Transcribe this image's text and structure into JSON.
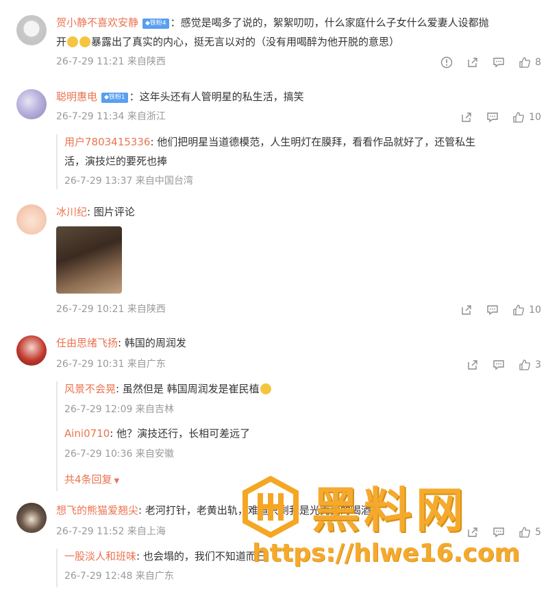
{
  "comments": [
    {
      "username": "贺小静不喜欢安静",
      "badge": "◆铁粉4",
      "text1": "：感觉是喝多了说的，絮絮叨叨，什么家庭什么子女什么爱妻人设都抛",
      "text2a": "开",
      "text2b": "暴露出了真实的内心，挺无言以对的（没有用喝醉为他开脱的意思）",
      "time": "26-7-29 11:21 来自陕西",
      "likes": "8"
    },
    {
      "username": "聪明惠电",
      "badge": "◆铁粉1",
      "text1": "：这年头还有人管明星的私生活，搞笑",
      "time": "26-7-29 11:34 来自浙江",
      "likes": "10",
      "reply": {
        "username": "用户7803415336",
        "text1": ": 他们把明星当道德模范，人生明灯在膜拜，看看作品就好了，还管私生",
        "text2": "活，演技烂的要死也捧",
        "time": "26-7-29 13:37 来自中国台湾"
      }
    },
    {
      "username": "冰川纪",
      "text1": ": 图片评论",
      "time": "26-7-29 10:21 来自陕西",
      "likes": "10"
    },
    {
      "username": "任由思绪飞扬",
      "text1": ": 韩国的周润发",
      "time": "26-7-29 10:31 来自广东",
      "likes": "3",
      "replies": [
        {
          "username": "风景不会晃",
          "text": ": 虽然但是 韩国周润发是崔民植",
          "time": "26-7-29 12:09 来自吉林"
        },
        {
          "username": "Aini0710",
          "text": ": 他？演技还行，长相可差远了",
          "time": "26-7-29 10:36 来自安徽"
        }
      ],
      "more": "共4条回复"
    },
    {
      "username": "想飞的熊猫爱翘尖",
      "text1": ": 老河打针，老黄出轨，难道只剩我是光秃秃的喝酒？",
      "time": "26-7-29 11:52 来自上海",
      "likes": "5",
      "reply": {
        "username": "一股淡人和班味",
        "text": ": 也会塌的，我们不知道而已",
        "time": "26-7-29 12:48 来自广东"
      }
    }
  ],
  "watermark": {
    "title": "黑料网",
    "url": "https://hlwe16.com"
  }
}
